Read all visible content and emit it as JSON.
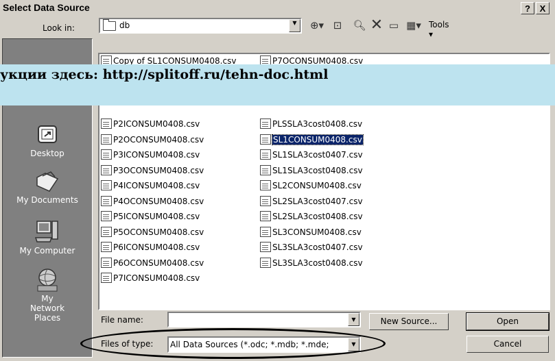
{
  "window": {
    "title": "Select Data Source",
    "help_label": "?",
    "close_label": "X"
  },
  "lookin": {
    "label": "Look in:",
    "value": "db"
  },
  "toolbar": {
    "tools_label": "Tools"
  },
  "places": [
    {
      "label": "Desktop",
      "icon": "desktop-icon"
    },
    {
      "label": "My Documents",
      "icon": "my-documents-icon"
    },
    {
      "label": "My Computer",
      "icon": "my-computer-icon"
    },
    {
      "label": "My Network Places",
      "icon": "my-network-places-icon"
    }
  ],
  "files": {
    "col1": [
      "Copy of SL1CONSUM0408.csv",
      "P2ICONSUM0408.csv",
      "P2OCONSUM0408.csv",
      "P3ICONSUM0408.csv",
      "P3OCONSUM0408.csv",
      "P4ICONSUM0408.csv",
      "P4OCONSUM0408.csv",
      "P5ICONSUM0408.csv",
      "P5OCONSUM0408.csv",
      "P6ICONSUM0408.csv",
      "P6OCONSUM0408.csv",
      "P7ICONSUM0408.csv"
    ],
    "col2": [
      "P7OCONSUM0408.csv",
      "PLSSLA3cost0408.csv",
      "SL1CONSUM0408.csv",
      "SL1SLA3cost0407.csv",
      "SL1SLA3cost0408.csv",
      "SL2CONSUM0408.csv",
      "SL2SLA3cost0407.csv",
      "SL2SLA3cost0408.csv",
      "SL3CONSUM0408.csv",
      "SL3SLA3cost0407.csv",
      "SL3SLA3cost0408.csv"
    ],
    "selected": "SL1CONSUM0408.csv"
  },
  "banner": {
    "text": "укции здесь: http://splitoff.ru/tehn-doc.html"
  },
  "form": {
    "filename_label": "File name:",
    "filename_value": "",
    "filetype_label": "Files of type:",
    "filetype_value": "All Data Sources (*.odc; *.mdb; *.mde;",
    "new_source_label": "New Source...",
    "open_label": "Open",
    "cancel_label": "Cancel"
  }
}
